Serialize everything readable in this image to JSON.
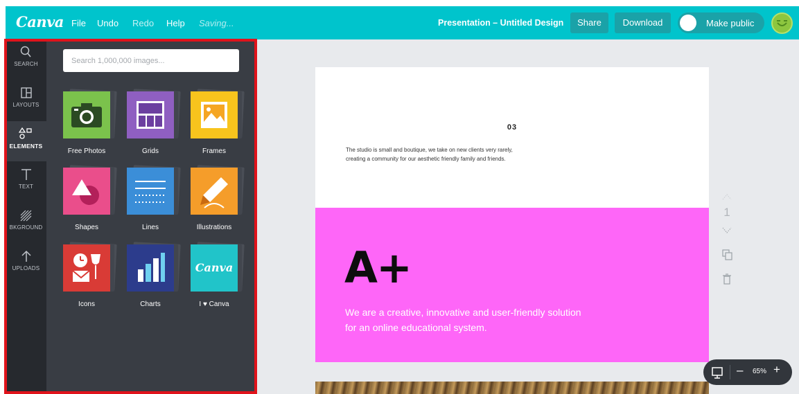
{
  "topbar": {
    "logo": "Canva",
    "menu": [
      "File",
      "Undo",
      "Redo",
      "Help"
    ],
    "status": "Saving...",
    "title": "Presentation – Untitled Design",
    "share_label": "Share",
    "download_label": "Download",
    "public_label": "Make public",
    "accent_color": "#00c4cc"
  },
  "rail": {
    "items": [
      {
        "label": "SEARCH",
        "icon": "search-icon"
      },
      {
        "label": "LAYOUTS",
        "icon": "layouts-icon"
      },
      {
        "label": "ELEMENTS",
        "icon": "elements-icon"
      },
      {
        "label": "TEXT",
        "icon": "text-icon"
      },
      {
        "label": "BKGROUND",
        "icon": "background-icon"
      },
      {
        "label": "UPLOADS",
        "icon": "upload-icon"
      }
    ],
    "active": "ELEMENTS"
  },
  "panel": {
    "search_placeholder": "Search 1,000,000 images...",
    "tiles": [
      {
        "label": "Free Photos",
        "icon": "camera-icon",
        "color": "#7bc24c"
      },
      {
        "label": "Grids",
        "icon": "grid-icon",
        "color": "#8f5fc1"
      },
      {
        "label": "Frames",
        "icon": "frame-icon",
        "color": "#f8c41d"
      },
      {
        "label": "Shapes",
        "icon": "shapes-icon",
        "color": "#ea4e8b"
      },
      {
        "label": "Lines",
        "icon": "lines-icon",
        "color": "#3b8ed8"
      },
      {
        "label": "Illustrations",
        "icon": "pencil-icon",
        "color": "#f59d2a"
      },
      {
        "label": "Icons",
        "icon": "icons-icon",
        "color": "#d93b36"
      },
      {
        "label": "Charts",
        "icon": "chart-icon",
        "color": "#2c3c8c"
      },
      {
        "label": "I ♥ Canva",
        "icon": "canva-logo-icon",
        "color": "#21c4c9"
      }
    ]
  },
  "canvas": {
    "page_number": "03",
    "body_text": "The studio is small and boutique, we take on new clients very rarely, creating a community for our aesthetic friendly family and friends.",
    "headline": "A+",
    "tagline": "We are a creative, innovative and user-friendly solution for an online educational system.",
    "pink_color": "#fe66f8",
    "page_indicator": "1",
    "zoom_level": "65%",
    "zoom_minus": "–",
    "zoom_plus": "+"
  }
}
